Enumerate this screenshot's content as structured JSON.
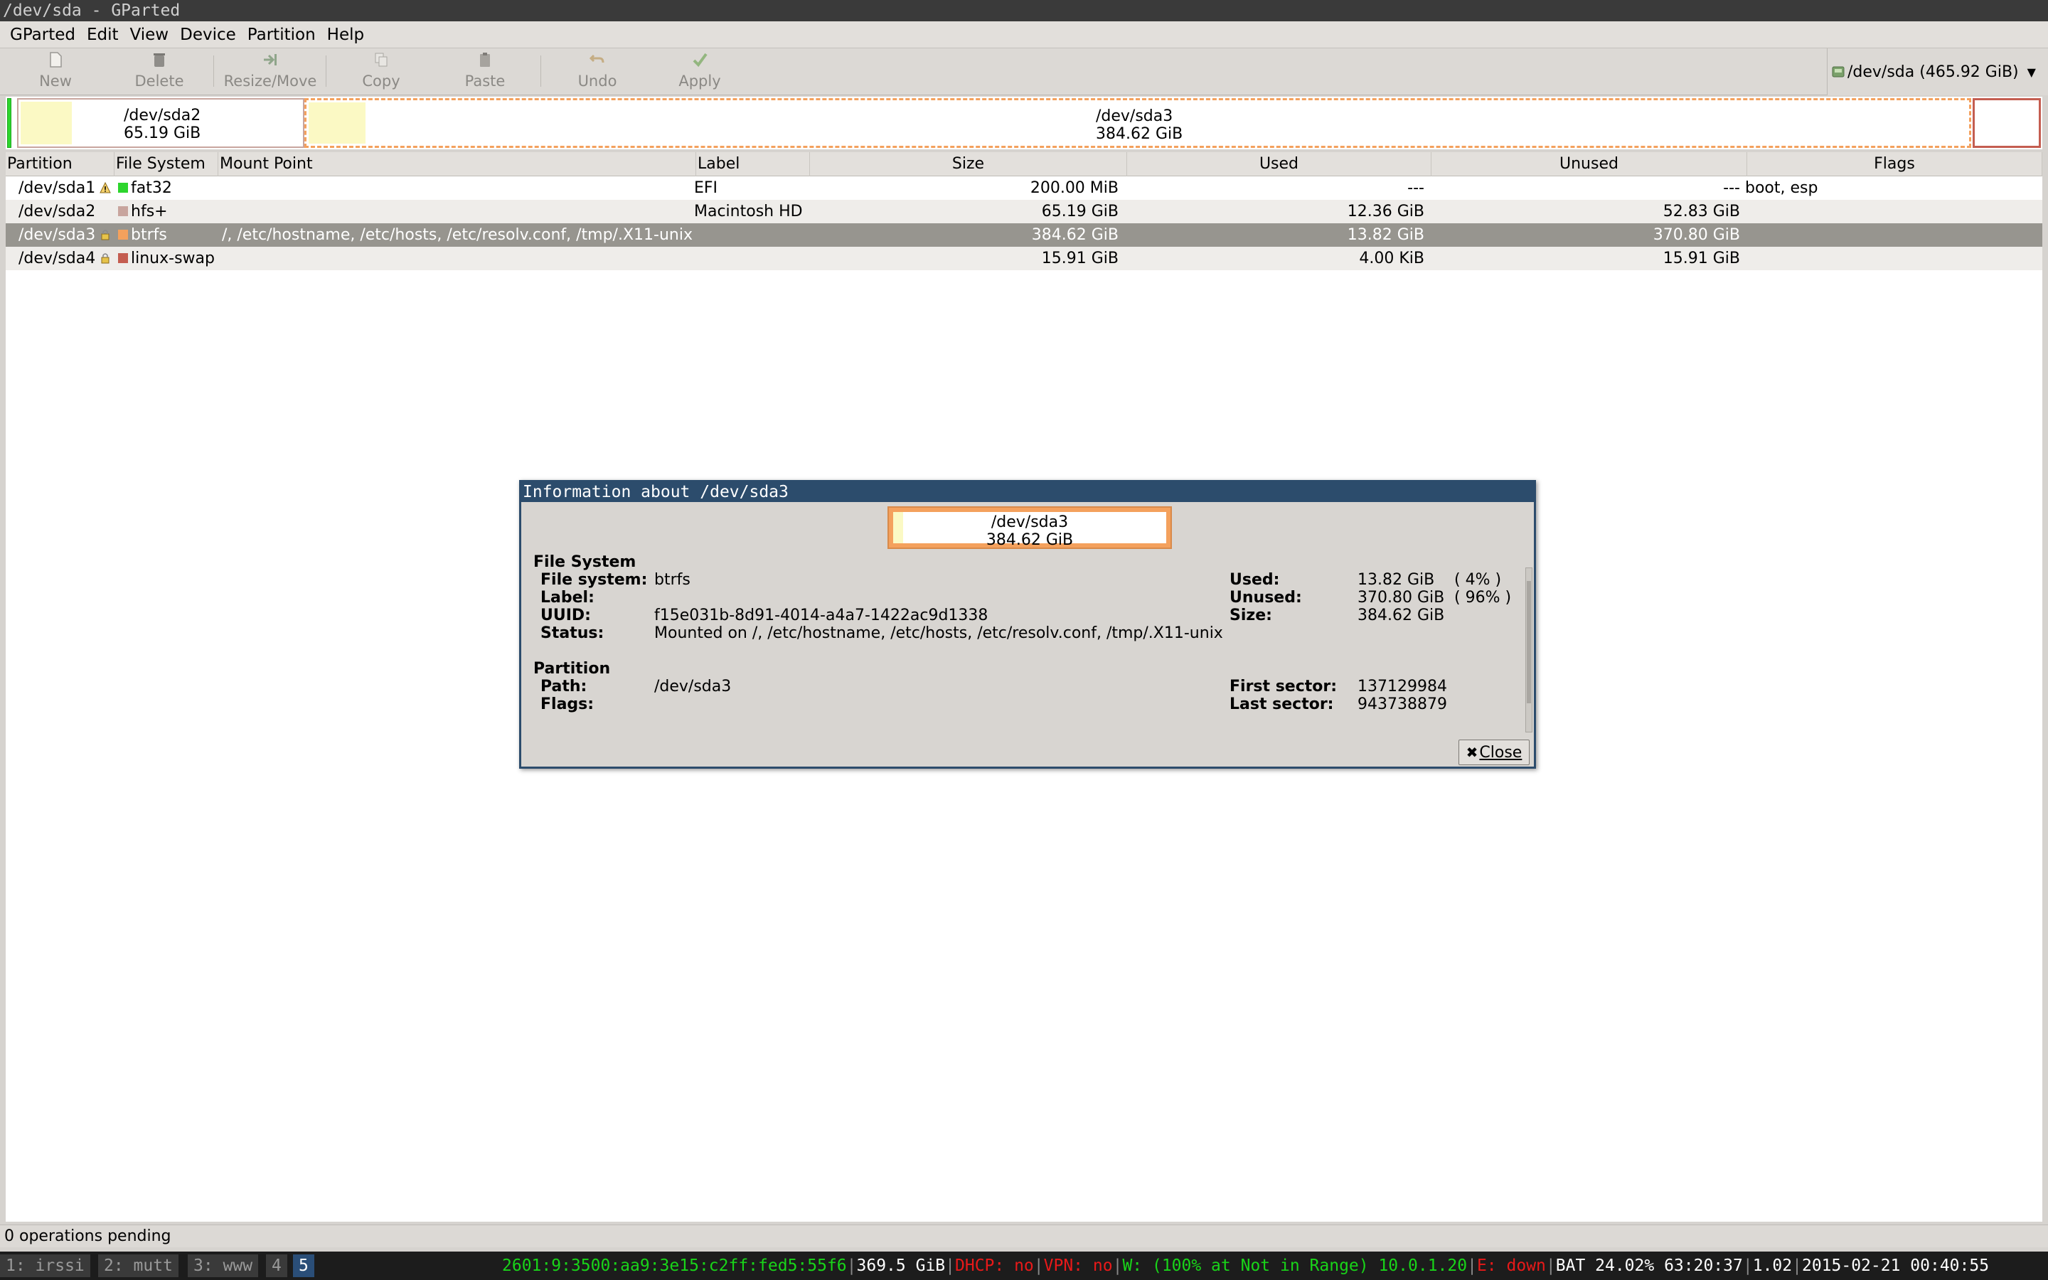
{
  "window_title": "/dev/sda - GParted",
  "menu": [
    "GParted",
    "Edit",
    "View",
    "Device",
    "Partition",
    "Help"
  ],
  "toolbar": {
    "new": "New",
    "delete": "Delete",
    "resize_move": "Resize/Move",
    "copy": "Copy",
    "paste": "Paste",
    "undo": "Undo",
    "apply": "Apply"
  },
  "device_selector": "/dev/sda (465.92 GiB)",
  "partition_map": {
    "sda2": {
      "name": "/dev/sda2",
      "size": "65.19 GiB"
    },
    "sda3": {
      "name": "/dev/sda3",
      "size": "384.62 GiB"
    }
  },
  "table": {
    "headers": {
      "partition": "Partition",
      "filesystem": "File System",
      "mount": "Mount Point",
      "label": "Label",
      "size": "Size",
      "used": "Used",
      "unused": "Unused",
      "flags": "Flags"
    },
    "rows": [
      {
        "partition": "/dev/sda1",
        "fs": "fat32",
        "fs_color": "#2dd52d",
        "mount": "",
        "label": "EFI",
        "size": "200.00 MiB",
        "used": "---",
        "unused": "---",
        "flags": "boot, esp",
        "icon": "warning"
      },
      {
        "partition": "/dev/sda2",
        "fs": "hfs+",
        "fs_color": "#c8a59e",
        "mount": "",
        "label": "Macintosh HD",
        "size": "65.19 GiB",
        "used": "12.36 GiB",
        "unused": "52.83 GiB",
        "flags": "",
        "icon": ""
      },
      {
        "partition": "/dev/sda3",
        "fs": "btrfs",
        "fs_color": "#f4a15d",
        "mount": "/, /etc/hostname, /etc/hosts, /etc/resolv.conf, /tmp/.X11-unix",
        "label": "",
        "size": "384.62 GiB",
        "used": "13.82 GiB",
        "unused": "370.80 GiB",
        "flags": "",
        "icon": "lock"
      },
      {
        "partition": "/dev/sda4",
        "fs": "linux-swap",
        "fs_color": "#c45d50",
        "mount": "",
        "label": "",
        "size": "15.91 GiB",
        "used": "4.00 KiB",
        "unused": "15.91 GiB",
        "flags": "",
        "icon": "lock"
      }
    ]
  },
  "dialog": {
    "title": "Information about /dev/sda3",
    "map_name": "/dev/sda3",
    "map_size": "384.62 GiB",
    "fs_section": "File System",
    "fs_key": "File system:",
    "fs_val": "btrfs",
    "label_key": "Label:",
    "label_val": "",
    "uuid_key": "UUID:",
    "uuid_val": "f15e031b-8d91-4014-a4a7-1422ac9d1338",
    "status_key": "Status:",
    "status_val": "Mounted on /, /etc/hostname, /etc/hosts, /etc/resolv.conf, /tmp/.X11-unix",
    "used_key": "Used:",
    "used_val": "13.82 GiB",
    "used_pct": "( 4% )",
    "unused_key": "Unused:",
    "unused_val": "370.80 GiB",
    "unused_pct": "( 96% )",
    "size_key": "Size:",
    "size_val": "384.62 GiB",
    "part_section": "Partition",
    "path_key": "Path:",
    "path_val": "/dev/sda3",
    "flags_key": "Flags:",
    "flags_val": "",
    "first_key": "First sector:",
    "first_val": "137129984",
    "last_key": "Last sector:",
    "last_val": "943738879",
    "close": "Close"
  },
  "status": "0 operations pending",
  "panel": {
    "workspaces": [
      "1: irssi",
      "2: mutt",
      "3: www",
      "4",
      "5"
    ],
    "ipv6": "2601:9:3500:aa9:3e15:c2ff:fed5:55f6",
    "disk": "369.5 GiB",
    "dhcp": "DHCP: no",
    "vpn": "VPN: no",
    "wifi": "W: (100% at Not in Range) 10.0.1.20",
    "eth": "E: down",
    "bat": "BAT 24.02% 63:20:37",
    "load": "1.02",
    "datetime": "2015-02-21 00:40:55",
    "colors": {
      "green": "#19d419",
      "red": "#e81919",
      "white": "#ffffff"
    }
  }
}
